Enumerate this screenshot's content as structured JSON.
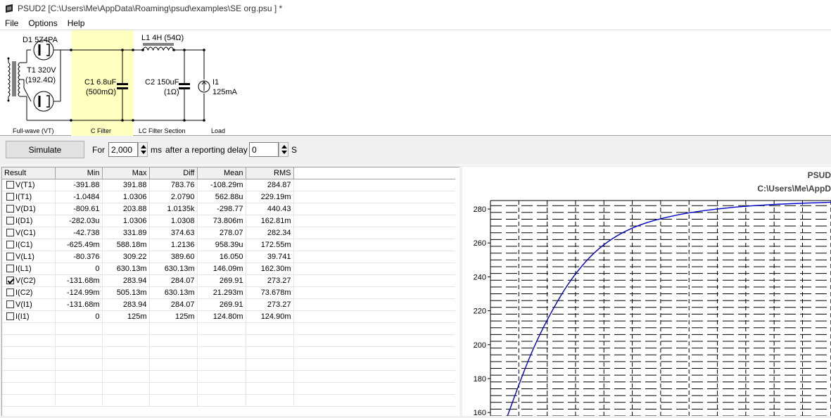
{
  "titlebar": {
    "title": "PSUD2  [C:\\Users\\Me\\AppData\\Roaming\\psud\\examples\\SE org.psu ] *"
  },
  "menu": [
    "File",
    "Options",
    "Help"
  ],
  "circuit": {
    "d1": "D1 5Z4PA",
    "t1_line1": "T1 320V",
    "t1_line2": "(192.4Ω)",
    "c1_line1": "C1 6.8uF",
    "c1_line2": "(500mΩ)",
    "l1": "L1 4H (54Ω)",
    "c2_line1": "C2 150uF",
    "c2_line2": "(1Ω)",
    "i1_line1": "I1",
    "i1_line2": "125mA",
    "sections": [
      "Full-wave (VT)",
      "C Filter",
      "LC Filter Section",
      "Load"
    ]
  },
  "simbar": {
    "simulate": "Simulate",
    "for_label": "For",
    "duration": "2,000",
    "ms_label": "ms",
    "after_label": "after a reporting delay of",
    "delay": "0",
    "s_label": "S"
  },
  "results": {
    "headers": [
      "Result",
      "Min",
      "Max",
      "Diff",
      "Mean",
      "RMS"
    ],
    "rows": [
      {
        "name": "V(T1)",
        "checked": false,
        "min": "-391.88",
        "max": "391.88",
        "diff": "783.76",
        "mean": "-108.29m",
        "rms": "284.87"
      },
      {
        "name": "I(T1)",
        "checked": false,
        "min": "-1.0484",
        "max": "1.0306",
        "diff": "2.0790",
        "mean": "562.88u",
        "rms": "229.19m"
      },
      {
        "name": "V(D1)",
        "checked": false,
        "min": "-809.61",
        "max": "203.88",
        "diff": "1.0135k",
        "mean": "-298.77",
        "rms": "440.43"
      },
      {
        "name": "I(D1)",
        "checked": false,
        "min": "-282.03u",
        "max": "1.0306",
        "diff": "1.0308",
        "mean": "73.806m",
        "rms": "162.81m"
      },
      {
        "name": "V(C1)",
        "checked": false,
        "min": "-42.738",
        "max": "331.89",
        "diff": "374.63",
        "mean": "278.07",
        "rms": "282.34"
      },
      {
        "name": "I(C1)",
        "checked": false,
        "min": "-625.49m",
        "max": "588.18m",
        "diff": "1.2136",
        "mean": "958.39u",
        "rms": "172.55m"
      },
      {
        "name": "V(L1)",
        "checked": false,
        "min": "-80.376",
        "max": "309.22",
        "diff": "389.60",
        "mean": "16.050",
        "rms": "39.741"
      },
      {
        "name": "I(L1)",
        "checked": false,
        "min": "0",
        "max": "630.13m",
        "diff": "630.13m",
        "mean": "146.09m",
        "rms": "162.30m"
      },
      {
        "name": "V(C2)",
        "checked": true,
        "min": "-131.68m",
        "max": "283.94",
        "diff": "284.07",
        "mean": "269.91",
        "rms": "273.27"
      },
      {
        "name": "I(C2)",
        "checked": false,
        "min": "-124.99m",
        "max": "505.13m",
        "diff": "630.13m",
        "mean": "21.293m",
        "rms": "73.678m"
      },
      {
        "name": "V(I1)",
        "checked": false,
        "min": "-131.68m",
        "max": "283.94",
        "diff": "284.07",
        "mean": "269.91",
        "rms": "273.27"
      },
      {
        "name": "I(I1)",
        "checked": false,
        "min": "0",
        "max": "125m",
        "diff": "125m",
        "mean": "124.80m",
        "rms": "124.90m"
      }
    ]
  },
  "plot": {
    "title1": "PSUD",
    "title2": "C:\\Users\\Me\\AppD"
  },
  "chart_data": {
    "type": "line",
    "y_ticks": [
      160,
      180,
      200,
      220,
      240,
      260,
      280
    ],
    "ylim": [
      158,
      285
    ],
    "grid": true,
    "series": [
      {
        "color": "#0000cc",
        "points": [
          [
            0.05,
            158
          ],
          [
            0.09,
            180
          ],
          [
            0.13,
            200
          ],
          [
            0.18,
            220
          ],
          [
            0.24,
            240
          ],
          [
            0.32,
            258
          ],
          [
            0.42,
            270
          ],
          [
            0.55,
            277
          ],
          [
            0.7,
            281
          ],
          [
            0.85,
            283
          ],
          [
            1.0,
            284
          ]
        ]
      }
    ]
  }
}
